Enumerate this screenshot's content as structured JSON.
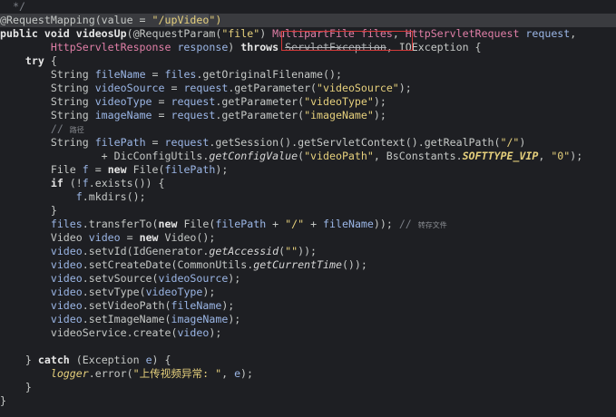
{
  "editor": {
    "lines": [
      [
        {
          "t": "  */",
          "c": "cmt"
        }
      ],
      [
        {
          "t": "@RequestMapping(value = ",
          "c": "ann"
        },
        {
          "t": "\"/",
          "c": "str"
        },
        {
          "t": "upVideo",
          "c": "str sel"
        },
        {
          "t": "\")",
          "c": "str"
        }
      ],
      [
        {
          "t": "public void ",
          "c": "kw"
        },
        {
          "t": "videosUp",
          "c": "kw"
        },
        {
          "t": "(@RequestParam(",
          "c": "ann"
        },
        {
          "t": "\"file\"",
          "c": "str"
        },
        {
          "t": ") ",
          "c": "ann"
        },
        {
          "t": "MultipartFile ",
          "c": "pink"
        },
        {
          "t": "files",
          "c": "pink"
        },
        {
          "t": ", ",
          "c": "ann"
        },
        {
          "t": "HttpServletRequest ",
          "c": "pink"
        },
        {
          "t": "request",
          "c": "param"
        },
        {
          "t": ",",
          "c": "ann"
        }
      ],
      [
        {
          "t": "        HttpServletResponse ",
          "c": "pink"
        },
        {
          "t": "response",
          "c": "param"
        },
        {
          "t": ") ",
          "c": "ann"
        },
        {
          "t": "throws ",
          "c": "kw"
        },
        {
          "t": "ServletException",
          "c": "strike"
        },
        {
          "t": ", IOException {",
          "c": "ann"
        }
      ],
      [
        {
          "t": "    try ",
          "c": "kw"
        },
        {
          "t": "{",
          "c": "ann"
        }
      ],
      [
        {
          "t": "        String ",
          "c": "type"
        },
        {
          "t": "fileName",
          "c": "var"
        },
        {
          "t": " = ",
          "c": "ann"
        },
        {
          "t": "files",
          "c": "var"
        },
        {
          "t": ".getOriginalFilename();",
          "c": "mth"
        }
      ],
      [
        {
          "t": "        String ",
          "c": "type"
        },
        {
          "t": "videoSource",
          "c": "var"
        },
        {
          "t": " = ",
          "c": "ann"
        },
        {
          "t": "request",
          "c": "var"
        },
        {
          "t": ".getParameter(",
          "c": "mth"
        },
        {
          "t": "\"videoSource\"",
          "c": "str"
        },
        {
          "t": ");",
          "c": "mth"
        }
      ],
      [
        {
          "t": "        String ",
          "c": "type"
        },
        {
          "t": "videoType",
          "c": "var"
        },
        {
          "t": " = ",
          "c": "ann"
        },
        {
          "t": "request",
          "c": "var"
        },
        {
          "t": ".getParameter(",
          "c": "mth"
        },
        {
          "t": "\"videoType\"",
          "c": "str"
        },
        {
          "t": ");",
          "c": "mth"
        }
      ],
      [
        {
          "t": "        String ",
          "c": "type"
        },
        {
          "t": "imageName",
          "c": "var"
        },
        {
          "t": " = ",
          "c": "ann"
        },
        {
          "t": "request",
          "c": "var"
        },
        {
          "t": ".getParameter(",
          "c": "mth"
        },
        {
          "t": "\"imageName\"",
          "c": "str"
        },
        {
          "t": ");",
          "c": "mth"
        }
      ],
      [
        {
          "t": "        // ",
          "c": "cmt"
        },
        {
          "t": "路径",
          "c": "cmt-cn"
        }
      ],
      [
        {
          "t": "        String ",
          "c": "type"
        },
        {
          "t": "filePath",
          "c": "var"
        },
        {
          "t": " = ",
          "c": "ann"
        },
        {
          "t": "request",
          "c": "var"
        },
        {
          "t": ".getSession().getServletContext().getRealPath(",
          "c": "mth"
        },
        {
          "t": "\"/\"",
          "c": "str"
        },
        {
          "t": ")",
          "c": "mth"
        }
      ],
      [
        {
          "t": "                + DicConfigUtils.",
          "c": "ann"
        },
        {
          "t": "getConfigValue",
          "c": "fn-ital"
        },
        {
          "t": "(",
          "c": "ann"
        },
        {
          "t": "\"videoPath\"",
          "c": "str"
        },
        {
          "t": ", BsConstants.",
          "c": "ann"
        },
        {
          "t": "SOFTTYPE_VIP",
          "c": "const"
        },
        {
          "t": ", ",
          "c": "ann"
        },
        {
          "t": "\"0\"",
          "c": "str"
        },
        {
          "t": ");",
          "c": "ann"
        }
      ],
      [
        {
          "t": "        File ",
          "c": "type"
        },
        {
          "t": "f",
          "c": "var"
        },
        {
          "t": " = ",
          "c": "ann"
        },
        {
          "t": "new ",
          "c": "kw"
        },
        {
          "t": "File(",
          "c": "ann"
        },
        {
          "t": "filePath",
          "c": "var"
        },
        {
          "t": ");",
          "c": "ann"
        }
      ],
      [
        {
          "t": "        if ",
          "c": "kw"
        },
        {
          "t": "(!",
          "c": "ann"
        },
        {
          "t": "f",
          "c": "var"
        },
        {
          "t": ".exists()) {",
          "c": "ann"
        }
      ],
      [
        {
          "t": "            f",
          "c": "var"
        },
        {
          "t": ".mkdirs();",
          "c": "ann"
        }
      ],
      [
        {
          "t": "        }",
          "c": "ann"
        }
      ],
      [
        {
          "t": "        files",
          "c": "var"
        },
        {
          "t": ".transferTo(",
          "c": "ann"
        },
        {
          "t": "new ",
          "c": "kw"
        },
        {
          "t": "File(",
          "c": "ann"
        },
        {
          "t": "filePath",
          "c": "var"
        },
        {
          "t": " + ",
          "c": "ann"
        },
        {
          "t": "\"/\"",
          "c": "str"
        },
        {
          "t": " + ",
          "c": "ann"
        },
        {
          "t": "fileName",
          "c": "var"
        },
        {
          "t": ")); ",
          "c": "ann"
        },
        {
          "t": "// ",
          "c": "cmt"
        },
        {
          "t": "转存文件",
          "c": "cmt-cn"
        }
      ],
      [
        {
          "t": "        Video ",
          "c": "type"
        },
        {
          "t": "video",
          "c": "var"
        },
        {
          "t": " = ",
          "c": "ann"
        },
        {
          "t": "new ",
          "c": "kw"
        },
        {
          "t": "Video();",
          "c": "ann"
        }
      ],
      [
        {
          "t": "        video",
          "c": "var"
        },
        {
          "t": ".setvId(IdGenerator.",
          "c": "ann"
        },
        {
          "t": "getAccessid",
          "c": "fn-ital"
        },
        {
          "t": "(",
          "c": "ann"
        },
        {
          "t": "\"\"",
          "c": "str"
        },
        {
          "t": "));",
          "c": "ann"
        }
      ],
      [
        {
          "t": "        video",
          "c": "var"
        },
        {
          "t": ".setCreateDate(CommonUtils.",
          "c": "ann"
        },
        {
          "t": "getCurrentTime",
          "c": "fn-ital"
        },
        {
          "t": "());",
          "c": "ann"
        }
      ],
      [
        {
          "t": "        video",
          "c": "var"
        },
        {
          "t": ".setvSource(",
          "c": "ann"
        },
        {
          "t": "videoSource",
          "c": "var"
        },
        {
          "t": ");",
          "c": "ann"
        }
      ],
      [
        {
          "t": "        video",
          "c": "var"
        },
        {
          "t": ".setvType(",
          "c": "ann"
        },
        {
          "t": "videoType",
          "c": "var"
        },
        {
          "t": ");",
          "c": "ann"
        }
      ],
      [
        {
          "t": "        video",
          "c": "var"
        },
        {
          "t": ".setVideoPath(",
          "c": "ann"
        },
        {
          "t": "fileName",
          "c": "var"
        },
        {
          "t": ");",
          "c": "ann"
        }
      ],
      [
        {
          "t": "        video",
          "c": "var"
        },
        {
          "t": ".setImageName(",
          "c": "ann"
        },
        {
          "t": "imageName",
          "c": "var"
        },
        {
          "t": ");",
          "c": "ann"
        }
      ],
      [
        {
          "t": "        videoService",
          "c": "ann"
        },
        {
          "t": ".create(",
          "c": "ann"
        },
        {
          "t": "video",
          "c": "var"
        },
        {
          "t": ");",
          "c": "ann"
        }
      ],
      [
        {
          "t": "",
          "c": "ann"
        }
      ],
      [
        {
          "t": "    } ",
          "c": "ann"
        },
        {
          "t": "catch ",
          "c": "kw"
        },
        {
          "t": "(Exception ",
          "c": "ann"
        },
        {
          "t": "e",
          "c": "var"
        },
        {
          "t": ") {",
          "c": "ann"
        }
      ],
      [
        {
          "t": "        logger",
          "c": "logger"
        },
        {
          "t": ".error(",
          "c": "ann"
        },
        {
          "t": "\"上传视频异常: \"",
          "c": "str"
        },
        {
          "t": ", ",
          "c": "ann"
        },
        {
          "t": "e",
          "c": "var"
        },
        {
          "t": ");",
          "c": "ann"
        }
      ],
      [
        {
          "t": "    }",
          "c": "ann"
        }
      ],
      [
        {
          "t": "}",
          "c": "ann"
        }
      ]
    ]
  },
  "colors": {
    "background": "#1e1f23",
    "highlight_box": "#d43a3a"
  }
}
